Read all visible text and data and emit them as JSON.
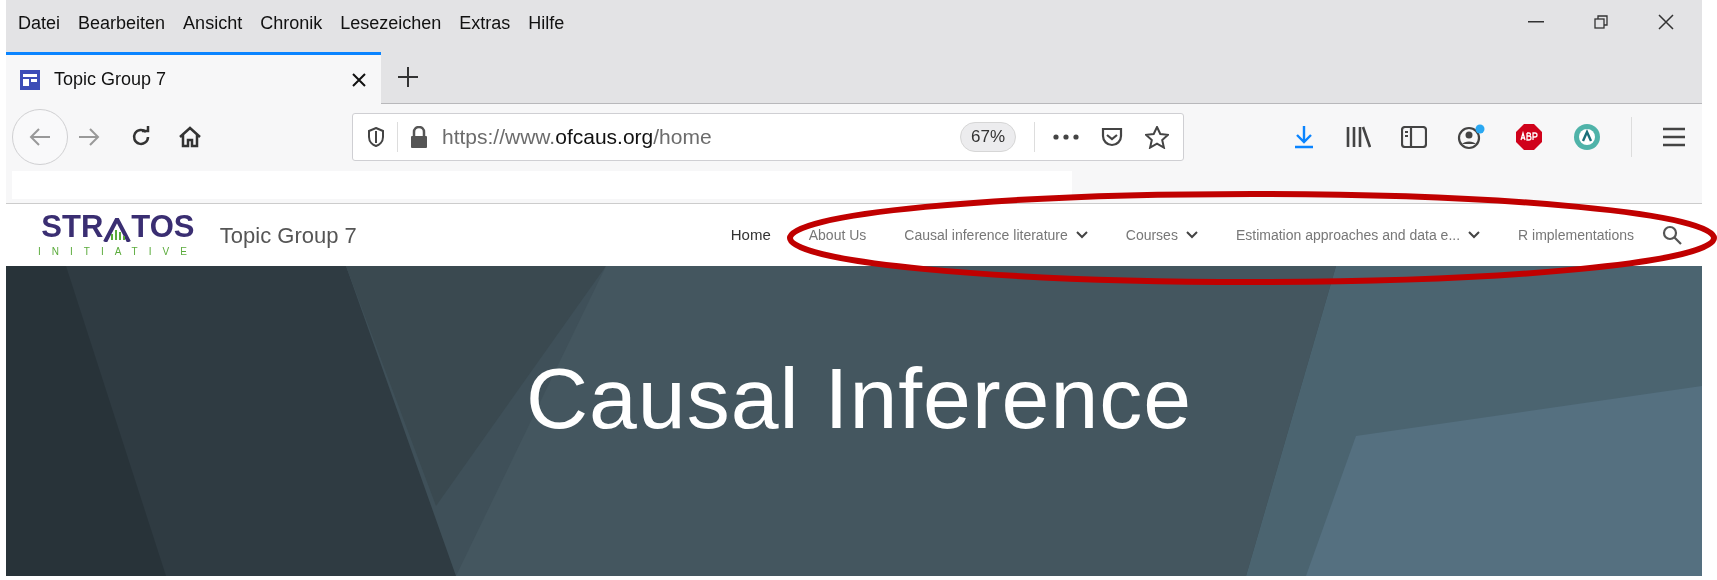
{
  "menu_bar": [
    "Datei",
    "Bearbeiten",
    "Ansicht",
    "Chronik",
    "Lesezeichen",
    "Extras",
    "Hilfe"
  ],
  "tabs": [
    {
      "title": "Topic Group 7",
      "selected": true
    }
  ],
  "address_bar": {
    "url_prefix": "https://www.",
    "url_domain": "ofcaus.org",
    "url_path": "/home",
    "zoom": "67%"
  },
  "site": {
    "logo_main": "STR",
    "logo_main_after": "TOS",
    "logo_sub": "INITIATIVE",
    "site_title": "Topic Group 7",
    "nav": [
      {
        "label": "Home",
        "selected": true,
        "dropdown": false
      },
      {
        "label": "About Us",
        "selected": false,
        "dropdown": false
      },
      {
        "label": "Causal inference literature",
        "selected": false,
        "dropdown": true
      },
      {
        "label": "Courses",
        "selected": false,
        "dropdown": true
      },
      {
        "label": "Estimation approaches and data e...",
        "selected": false,
        "dropdown": true
      },
      {
        "label": "R implementations",
        "selected": false,
        "dropdown": false
      }
    ],
    "hero_title": "Causal Inference"
  },
  "annotation": {
    "kind": "ellipse",
    "color": "#c00000"
  }
}
